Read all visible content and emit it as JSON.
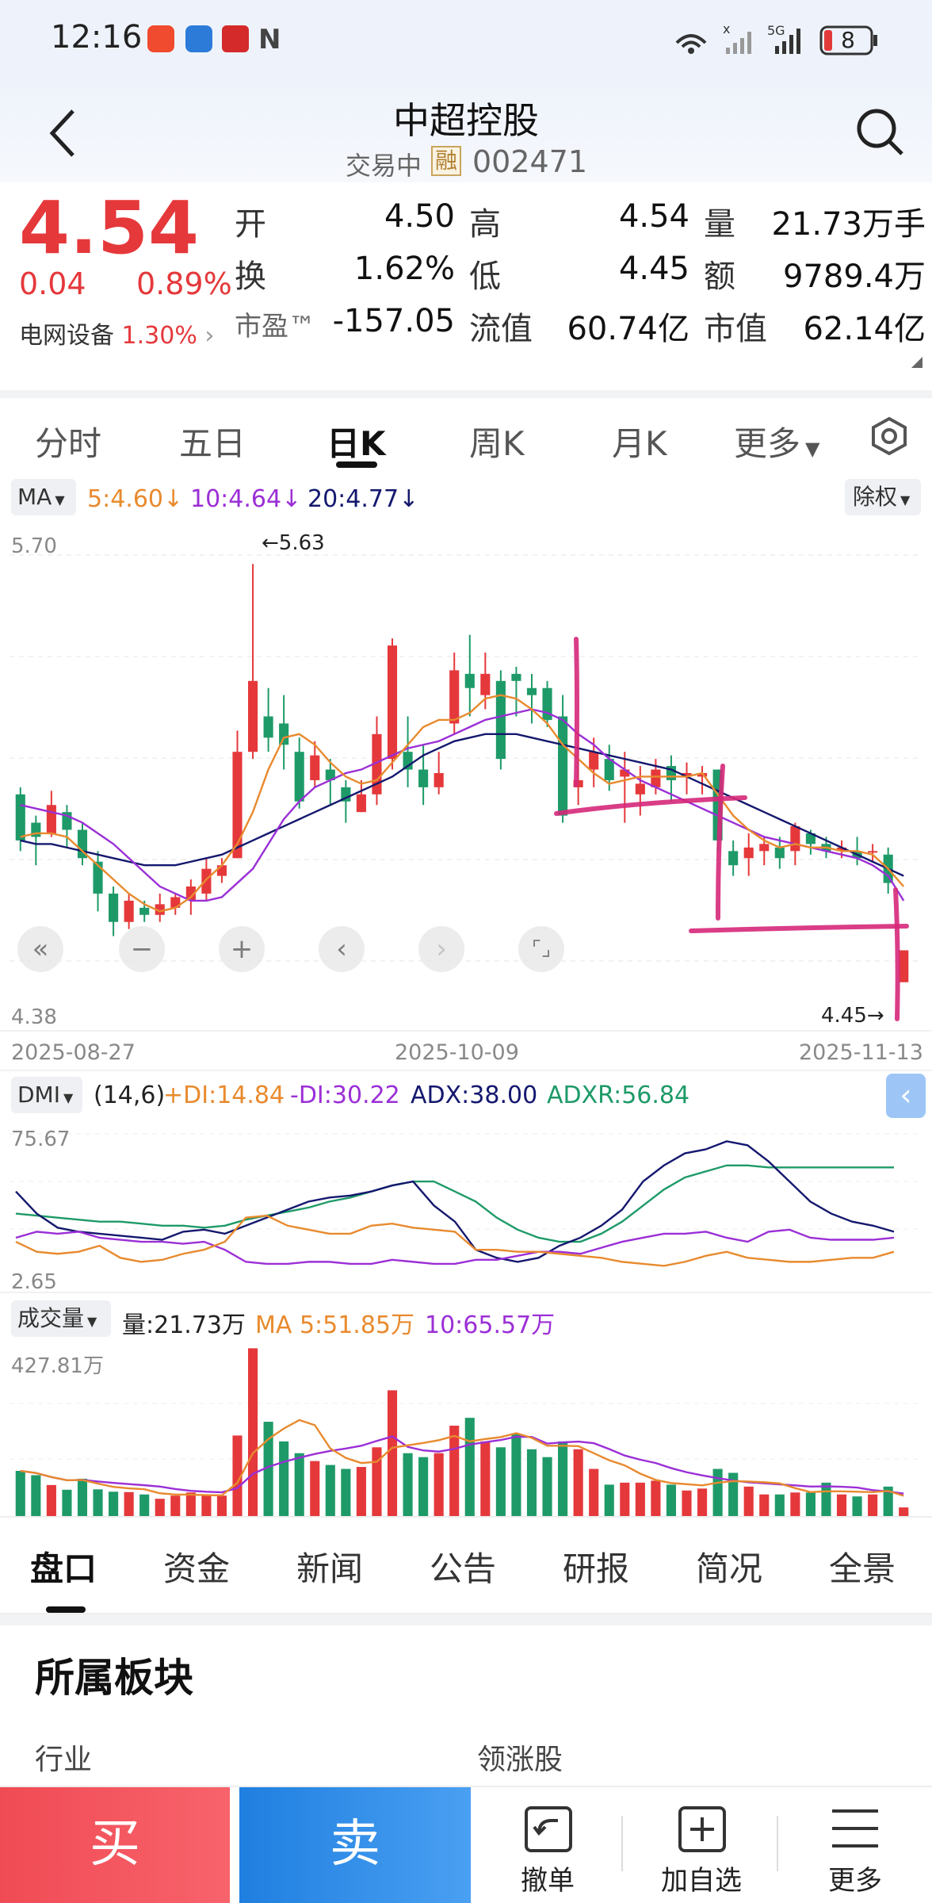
{
  "status_bar": {
    "time": "12:16",
    "battery": "8"
  },
  "header": {
    "title": "中超控股",
    "trading_status": "交易中",
    "margin_badge": "融",
    "code": "002471"
  },
  "quote": {
    "price": "4.54",
    "change": "0.04",
    "change_pct": "0.89%",
    "sector_name": "电网设备",
    "sector_pct": "1.30%",
    "open_label": "开",
    "open": "4.50",
    "high_label": "高",
    "high": "4.54",
    "volume_label": "量",
    "volume": "21.73万手",
    "turnover_label": "换",
    "turnover": "1.62%",
    "low_label": "低",
    "low": "4.45",
    "amount_label": "额",
    "amount": "9789.4万",
    "pe_label": "市盈™",
    "pe": "-157.05",
    "float_cap_label": "流值",
    "float_cap": "60.74亿",
    "mkt_cap_label": "市值",
    "mkt_cap": "62.14亿"
  },
  "tabs": [
    "分时",
    "五日",
    "日K",
    "周K",
    "月K",
    "更多"
  ],
  "active_tab": "日K",
  "kline": {
    "ma_selector": "MA",
    "ma5": "5:4.60↓",
    "ma10": "10:4.64↓",
    "ma20": "20:4.77↓",
    "adjust": "除权",
    "y_top": "5.70",
    "y_bottom": "4.38",
    "max_label": "←5.63",
    "min_label": "4.45→",
    "dates": [
      "2025-08-27",
      "2025-10-09",
      "2025-11-13"
    ]
  },
  "dmi": {
    "selector": "DMI",
    "params": "(14,6)",
    "pdi": "+DI:14.84",
    "mdi": "-DI:30.22",
    "adx": "ADX:38.00",
    "adxr": "ADXR:56.84",
    "y_top": "75.67",
    "y_bottom": "2.65"
  },
  "volume_panel": {
    "selector": "成交量",
    "vol": "量:21.73万",
    "ma5": "MA 5:51.85万",
    "ma10": "10:65.57万",
    "y_top": "427.81万"
  },
  "bottom_tabs": [
    "盘口",
    "资金",
    "新闻",
    "公告",
    "研报",
    "简况",
    "全景"
  ],
  "section": {
    "title": "所属板块",
    "industry": "行业",
    "leader": "领涨股"
  },
  "actions": {
    "buy": "买",
    "sell": "卖",
    "cancel": "撤单",
    "watch": "加自选",
    "more": "更多"
  },
  "colors": {
    "up": "#e5383b",
    "down": "#1e9a68",
    "ma5": "#e88a2e",
    "ma10": "#9b2fd6",
    "ma20": "#14186e",
    "annotation": "#d6287a"
  },
  "chart_data": {
    "type": "candlestick",
    "x_range": [
      "2025-08-27",
      "2025-11-13"
    ],
    "ylim": [
      4.38,
      5.7
    ],
    "high": 5.63,
    "low": 4.45,
    "ohlc": [
      [
        4.98,
        4.85,
        5.0,
        4.82
      ],
      [
        4.9,
        4.86,
        4.92,
        4.78
      ],
      [
        4.87,
        4.95,
        4.99,
        4.86
      ],
      [
        4.93,
        4.88,
        4.95,
        4.83
      ],
      [
        4.88,
        4.8,
        4.9,
        4.78
      ],
      [
        4.79,
        4.7,
        4.82,
        4.65
      ],
      [
        4.7,
        4.62,
        4.72,
        4.58
      ],
      [
        4.62,
        4.68,
        4.7,
        4.6
      ],
      [
        4.66,
        4.64,
        4.68,
        4.62
      ],
      [
        4.64,
        4.67,
        4.7,
        4.62
      ],
      [
        4.66,
        4.69,
        4.7,
        4.64
      ],
      [
        4.68,
        4.72,
        4.74,
        4.64
      ],
      [
        4.7,
        4.77,
        4.8,
        4.68
      ],
      [
        4.75,
        4.78,
        4.8,
        4.73
      ],
      [
        4.8,
        5.1,
        5.16,
        4.8
      ],
      [
        5.1,
        5.3,
        5.63,
        5.08
      ],
      [
        5.2,
        5.14,
        5.28,
        5.1
      ],
      [
        5.18,
        5.12,
        5.26,
        5.05
      ],
      [
        5.1,
        4.96,
        5.14,
        4.94
      ],
      [
        5.02,
        5.09,
        5.13,
        5.0
      ],
      [
        5.05,
        5.02,
        5.08,
        4.95
      ],
      [
        5.0,
        4.96,
        5.02,
        4.9
      ],
      [
        4.93,
        4.98,
        5.02,
        4.93
      ],
      [
        4.98,
        5.15,
        5.2,
        4.95
      ],
      [
        5.08,
        5.4,
        5.42,
        5.05
      ],
      [
        5.1,
        5.05,
        5.2,
        5.0
      ],
      [
        5.05,
        5.0,
        5.12,
        4.95
      ],
      [
        5.0,
        5.04,
        5.1,
        4.98
      ],
      [
        5.18,
        5.33,
        5.38,
        5.15
      ],
      [
        5.32,
        5.28,
        5.43,
        5.2
      ],
      [
        5.26,
        5.32,
        5.38,
        5.22
      ],
      [
        5.3,
        5.08,
        5.33,
        5.05
      ],
      [
        5.32,
        5.3,
        5.34,
        5.2
      ],
      [
        5.28,
        5.26,
        5.32,
        5.18
      ],
      [
        5.28,
        5.19,
        5.3,
        5.17
      ],
      [
        5.2,
        4.92,
        5.26,
        4.9
      ],
      [
        5.0,
        5.02,
        5.15,
        4.95
      ],
      [
        5.05,
        5.1,
        5.14,
        5.0
      ],
      [
        5.08,
        5.02,
        5.12,
        4.99
      ],
      [
        5.03,
        5.05,
        5.1,
        4.9
      ],
      [
        4.98,
        5.01,
        5.06,
        4.92
      ],
      [
        5.0,
        5.05,
        5.08,
        4.98
      ],
      [
        5.06,
        5.02,
        5.09,
        4.96
      ],
      [
        5.03,
        5.04,
        5.07,
        4.98
      ],
      [
        5.03,
        5.04,
        5.06,
        4.98
      ],
      [
        5.05,
        4.85,
        5.05,
        4.82
      ],
      [
        4.82,
        4.78,
        4.85,
        4.75
      ],
      [
        4.8,
        4.83,
        4.87,
        4.75
      ],
      [
        4.82,
        4.84,
        4.86,
        4.78
      ],
      [
        4.83,
        4.8,
        4.86,
        4.77
      ],
      [
        4.82,
        4.89,
        4.9,
        4.78
      ],
      [
        4.87,
        4.84,
        4.88,
        4.81
      ],
      [
        4.84,
        4.82,
        4.86,
        4.8
      ],
      [
        4.82,
        4.83,
        4.85,
        4.8
      ],
      [
        4.82,
        4.8,
        4.86,
        4.78
      ],
      [
        4.82,
        4.82,
        4.84,
        4.79
      ],
      [
        4.81,
        4.73,
        4.83,
        4.7
      ],
      [
        4.45,
        4.54,
        4.54,
        4.45
      ]
    ],
    "ma5": [
      4.86,
      4.87,
      4.87,
      4.86,
      4.82,
      4.78,
      4.74,
      4.7,
      4.67,
      4.65,
      4.66,
      4.69,
      4.74,
      4.78,
      4.84,
      4.93,
      5.05,
      5.14,
      5.15,
      5.12,
      5.07,
      5.03,
      5.01,
      5.02,
      5.07,
      5.12,
      5.17,
      5.19,
      5.19,
      5.21,
      5.25,
      5.26,
      5.25,
      5.22,
      5.18,
      5.12,
      5.08,
      5.04,
      5.01,
      5.02,
      5.03,
      5.03,
      5.03,
      5.03,
      5.04,
      4.98,
      4.92,
      4.88,
      4.85,
      4.83,
      4.84,
      4.83,
      4.83,
      4.82,
      4.82,
      4.81,
      4.77,
      4.72
    ],
    "ma10": [
      4.95,
      4.94,
      4.93,
      4.92,
      4.9,
      4.87,
      4.84,
      4.8,
      4.76,
      4.72,
      4.7,
      4.68,
      4.68,
      4.69,
      4.73,
      4.77,
      4.84,
      4.91,
      4.96,
      5.0,
      5.02,
      5.04,
      5.05,
      5.07,
      5.09,
      5.11,
      5.12,
      5.13,
      5.15,
      5.17,
      5.19,
      5.2,
      5.21,
      5.22,
      5.21,
      5.19,
      5.15,
      5.12,
      5.08,
      5.05,
      5.02,
      5.0,
      4.98,
      4.96,
      4.94,
      4.92,
      4.9,
      4.88,
      4.86,
      4.85,
      4.84,
      4.83,
      4.82,
      4.81,
      4.8,
      4.78,
      4.75,
      4.68
    ],
    "ma20": [
      4.85,
      4.84,
      4.84,
      4.83,
      4.82,
      4.81,
      4.8,
      4.79,
      4.78,
      4.78,
      4.78,
      4.79,
      4.8,
      4.81,
      4.83,
      4.85,
      4.87,
      4.89,
      4.91,
      4.93,
      4.95,
      4.97,
      4.99,
      5.01,
      5.03,
      5.06,
      5.09,
      5.11,
      5.13,
      5.14,
      5.15,
      5.15,
      5.15,
      5.14,
      5.13,
      5.12,
      5.11,
      5.1,
      5.09,
      5.08,
      5.07,
      5.06,
      5.05,
      5.03,
      5.01,
      4.99,
      4.97,
      4.95,
      4.93,
      4.91,
      4.89,
      4.87,
      4.85,
      4.83,
      4.81,
      4.79,
      4.77,
      4.75
    ],
    "volume": [
      115,
      104,
      79,
      67,
      95,
      68,
      62,
      61,
      55,
      44,
      52,
      60,
      55,
      52,
      205,
      427,
      240,
      190,
      160,
      140,
      130,
      120,
      125,
      175,
      320,
      160,
      150,
      160,
      230,
      250,
      190,
      175,
      210,
      170,
      150,
      190,
      170,
      120,
      80,
      85,
      85,
      90,
      80,
      65,
      70,
      120,
      110,
      75,
      55,
      55,
      60,
      60,
      85,
      55,
      50,
      55,
      75,
      22
    ],
    "dmi_pdi": [
      20,
      15,
      14,
      15,
      18,
      12,
      10,
      11,
      14,
      16,
      20,
      32,
      33,
      28,
      26,
      24,
      24,
      28,
      29,
      27,
      26,
      25,
      16,
      16,
      15,
      15,
      14,
      13,
      12,
      10,
      9,
      8,
      10,
      13,
      15,
      12,
      11,
      10,
      10,
      11,
      12,
      12,
      15
    ],
    "dmi_mdi": [
      22,
      25,
      24,
      25,
      22,
      21,
      20,
      20,
      19,
      20,
      16,
      10,
      9,
      9,
      10,
      10,
      9,
      9,
      11,
      10,
      9,
      9,
      11,
      11,
      13,
      15,
      15,
      14,
      17,
      20,
      22,
      24,
      24,
      25,
      22,
      20,
      25,
      26,
      22,
      21,
      21,
      21,
      22
    ],
    "dmi_adx": [
      45,
      34,
      27,
      25,
      24,
      23,
      22,
      21,
      25,
      26,
      24,
      28,
      32,
      36,
      40,
      42,
      43,
      45,
      48,
      50,
      38,
      30,
      16,
      12,
      10,
      12,
      18,
      22,
      28,
      36,
      50,
      58,
      64,
      66,
      70,
      68,
      60,
      50,
      40,
      34,
      30,
      28,
      25
    ],
    "dmi_adxr": [
      34,
      33,
      32,
      31,
      30,
      30,
      29,
      28,
      28,
      27,
      28,
      31,
      33,
      35,
      37,
      40,
      42,
      45,
      48,
      50,
      50,
      45,
      40,
      32,
      26,
      22,
      20,
      20,
      24,
      30,
      38,
      46,
      52,
      55,
      58,
      58,
      57,
      57,
      57,
      57,
      57,
      57,
      57
    ]
  }
}
